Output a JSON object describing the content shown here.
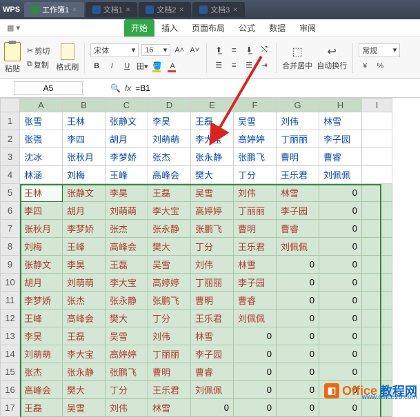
{
  "titlebar": {
    "app": "WPS",
    "tabs": [
      {
        "label": "工作簿1",
        "type": "s",
        "active": true
      },
      {
        "label": "文档1",
        "type": "w",
        "active": false
      },
      {
        "label": "文档2",
        "type": "w",
        "active": false
      },
      {
        "label": "文档3",
        "type": "w",
        "active": false
      }
    ]
  },
  "ribbon_tabs": [
    "开始",
    "插入",
    "页面布局",
    "公式",
    "数据",
    "审阅"
  ],
  "ribbon_active": "开始",
  "ribbon": {
    "cut": "剪切",
    "copy": "复制",
    "paste": "粘贴",
    "format_painter": "格式刷",
    "font_name": "宋体",
    "font_size": "16",
    "merge": "合并居中",
    "wrap": "自动换行",
    "general": "常规"
  },
  "cellref": "A5",
  "formula": "=B1",
  "columns": [
    "A",
    "B",
    "C",
    "D",
    "E",
    "F",
    "G",
    "H",
    "I"
  ],
  "rows_top": [
    [
      "张雪",
      "王林",
      "张静文",
      "李昊",
      "王磊",
      "吴雪",
      "刘伟",
      "林雪",
      ""
    ],
    [
      "张强",
      "李四",
      "胡月",
      "刘萌萌",
      "李大宝",
      "高婷婷",
      "丁丽丽",
      "李子园",
      ""
    ],
    [
      "沈冰",
      "张秋月",
      "李梦娇",
      "张杰",
      "张永静",
      "张鹏飞",
      "曹明",
      "曹睿",
      ""
    ],
    [
      "林涵",
      "刘梅",
      "王峰",
      "高峰会",
      "樊大",
      "丁分",
      "王乐君",
      "刘佩佩",
      ""
    ]
  ],
  "rows_sel": [
    [
      "王林",
      "张静文",
      "李昊",
      "王磊",
      "吴雪",
      "刘伟",
      "林雪",
      "0",
      ""
    ],
    [
      "李四",
      "胡月",
      "刘萌萌",
      "李大宝",
      "高婷婷",
      "丁丽丽",
      "李子园",
      "0",
      ""
    ],
    [
      "张秋月",
      "李梦娇",
      "张杰",
      "张永静",
      "张鹏飞",
      "曹明",
      "曹睿",
      "0",
      ""
    ],
    [
      "刘梅",
      "王峰",
      "高峰会",
      "樊大",
      "丁分",
      "王乐君",
      "刘佩佩",
      "0",
      ""
    ],
    [
      "张静文",
      "李昊",
      "王磊",
      "吴雪",
      "刘伟",
      "林雪",
      "0",
      "0",
      ""
    ],
    [
      "胡月",
      "刘萌萌",
      "李大宝",
      "高婷婷",
      "丁丽丽",
      "李子园",
      "0",
      "0",
      ""
    ],
    [
      "李梦娇",
      "张杰",
      "张永静",
      "张鹏飞",
      "曹明",
      "曹睿",
      "0",
      "0",
      ""
    ],
    [
      "王峰",
      "高峰会",
      "樊大",
      "丁分",
      "王乐君",
      "刘佩佩",
      "0",
      "0",
      ""
    ],
    [
      "李昊",
      "王磊",
      "吴雪",
      "刘伟",
      "林雪",
      "0",
      "0",
      "0",
      ""
    ],
    [
      "刘萌萌",
      "李大宝",
      "高婷婷",
      "丁丽丽",
      "李子园",
      "0",
      "0",
      "0",
      ""
    ],
    [
      "张杰",
      "张永静",
      "张鹏飞",
      "曹明",
      "曹睿",
      "0",
      "0",
      "0",
      ""
    ],
    [
      "高峰会",
      "樊大",
      "丁分",
      "王乐君",
      "刘佩佩",
      "0",
      "0",
      "0",
      ""
    ],
    [
      "王磊",
      "吴雪",
      "刘伟",
      "林雪",
      "0",
      "0",
      "0",
      "0",
      ""
    ]
  ],
  "watermark": {
    "brand1": "Office",
    "brand2": "教程网",
    "url": "www.office26.com"
  }
}
